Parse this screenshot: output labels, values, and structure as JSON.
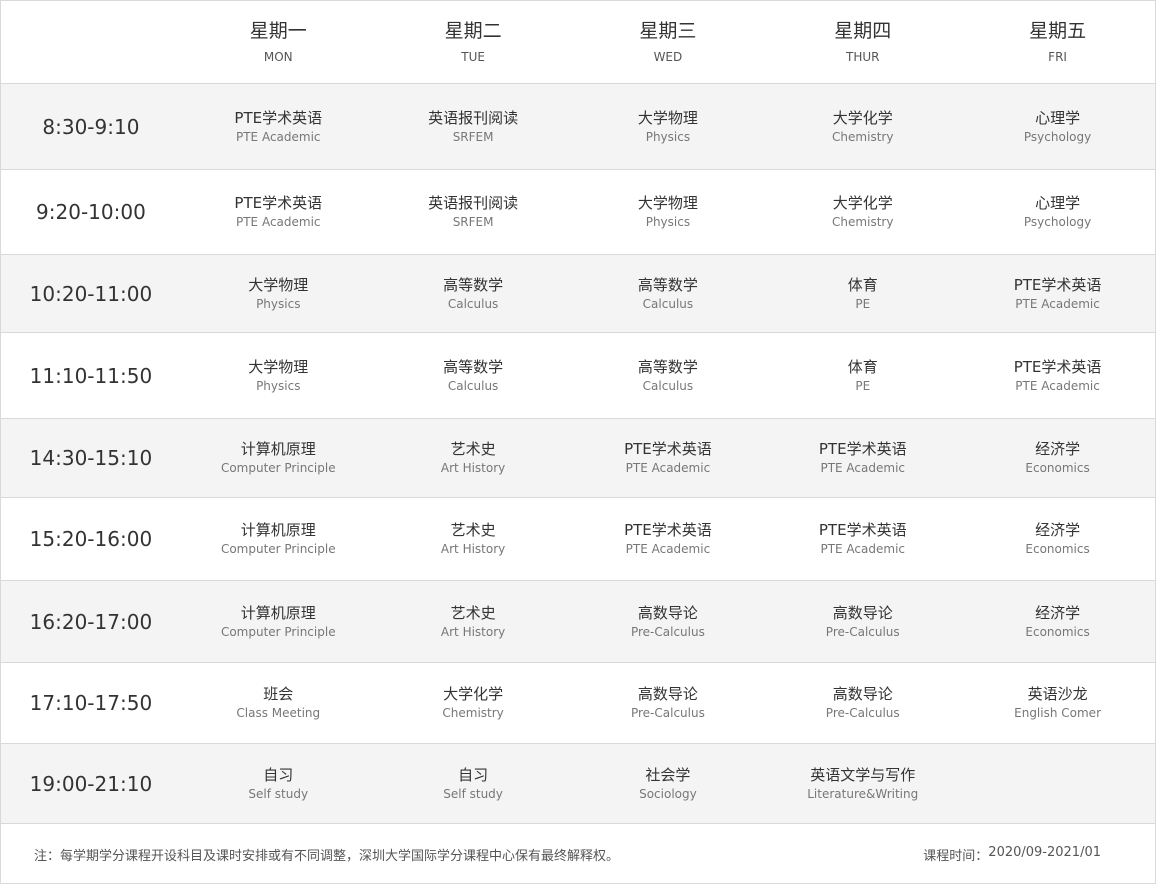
{
  "days": [
    {
      "cn": "星期一",
      "en": "MON"
    },
    {
      "cn": "星期二",
      "en": "TUE"
    },
    {
      "cn": "星期三",
      "en": "WED"
    },
    {
      "cn": "星期四",
      "en": "THUR"
    },
    {
      "cn": "星期五",
      "en": "FRI"
    }
  ],
  "rows": [
    {
      "time": "8:30-9:10",
      "cells": [
        {
          "cn": "PTE学术英语",
          "en": "PTE Academic"
        },
        {
          "cn": "英语报刊阅读",
          "en": "SRFEM"
        },
        {
          "cn": "大学物理",
          "en": "Physics"
        },
        {
          "cn": "大学化学",
          "en": "Chemistry"
        },
        {
          "cn": "心理学",
          "en": "Psychology"
        }
      ]
    },
    {
      "time": "9:20-10:00",
      "cells": [
        {
          "cn": "PTE学术英语",
          "en": "PTE Academic"
        },
        {
          "cn": "英语报刊阅读",
          "en": "SRFEM"
        },
        {
          "cn": "大学物理",
          "en": "Physics"
        },
        {
          "cn": "大学化学",
          "en": "Chemistry"
        },
        {
          "cn": "心理学",
          "en": "Psychology"
        }
      ]
    },
    {
      "time": "10:20-11:00",
      "cells": [
        {
          "cn": "大学物理",
          "en": "Physics"
        },
        {
          "cn": "高等数学",
          "en": "Calculus"
        },
        {
          "cn": "高等数学",
          "en": "Calculus"
        },
        {
          "cn": "体育",
          "en": "PE"
        },
        {
          "cn": "PTE学术英语",
          "en": "PTE Academic"
        }
      ]
    },
    {
      "time": "11:10-11:50",
      "cells": [
        {
          "cn": "大学物理",
          "en": "Physics"
        },
        {
          "cn": "高等数学",
          "en": "Calculus"
        },
        {
          "cn": "高等数学",
          "en": "Calculus"
        },
        {
          "cn": "体育",
          "en": "PE"
        },
        {
          "cn": "PTE学术英语",
          "en": "PTE Academic"
        }
      ]
    },
    {
      "time": "14:30-15:10",
      "cells": [
        {
          "cn": "计算机原理",
          "en": "Computer Principle"
        },
        {
          "cn": "艺术史",
          "en": "Art History"
        },
        {
          "cn": "PTE学术英语",
          "en": "PTE Academic"
        },
        {
          "cn": "PTE学术英语",
          "en": "PTE Academic"
        },
        {
          "cn": "经济学",
          "en": "Economics"
        }
      ]
    },
    {
      "time": "15:20-16:00",
      "cells": [
        {
          "cn": "计算机原理",
          "en": "Computer Principle"
        },
        {
          "cn": "艺术史",
          "en": "Art History"
        },
        {
          "cn": "PTE学术英语",
          "en": "PTE Academic"
        },
        {
          "cn": "PTE学术英语",
          "en": "PTE Academic"
        },
        {
          "cn": "经济学",
          "en": "Economics"
        }
      ]
    },
    {
      "time": "16:20-17:00",
      "cells": [
        {
          "cn": "计算机原理",
          "en": "Computer Principle"
        },
        {
          "cn": "艺术史",
          "en": "Art History"
        },
        {
          "cn": "高数导论",
          "en": "Pre-Calculus"
        },
        {
          "cn": "高数导论",
          "en": "Pre-Calculus"
        },
        {
          "cn": "经济学",
          "en": "Economics"
        }
      ]
    },
    {
      "time": "17:10-17:50",
      "cells": [
        {
          "cn": "班会",
          "en": "Class Meeting"
        },
        {
          "cn": "大学化学",
          "en": "Chemistry"
        },
        {
          "cn": "高数导论",
          "en": "Pre-Calculus"
        },
        {
          "cn": "高数导论",
          "en": "Pre-Calculus"
        },
        {
          "cn": "英语沙龙",
          "en": "English Comer"
        }
      ]
    },
    {
      "time": "19:00-21:10",
      "cells": [
        {
          "cn": "自习",
          "en": "Self study"
        },
        {
          "cn": "自习",
          "en": "Self study"
        },
        {
          "cn": "社会学",
          "en": "Sociology"
        },
        {
          "cn": "英语文学与写作",
          "en": "Literature&Writing"
        },
        {
          "cn": "",
          "en": ""
        }
      ]
    }
  ],
  "footer": {
    "note": "注：每学期学分课程开设科目及课时安排或有不同调整，深圳大学国际学分课程中心保有最终解释权。",
    "period_label": "课程时间：",
    "period_value": "2020/09-2021/01"
  }
}
